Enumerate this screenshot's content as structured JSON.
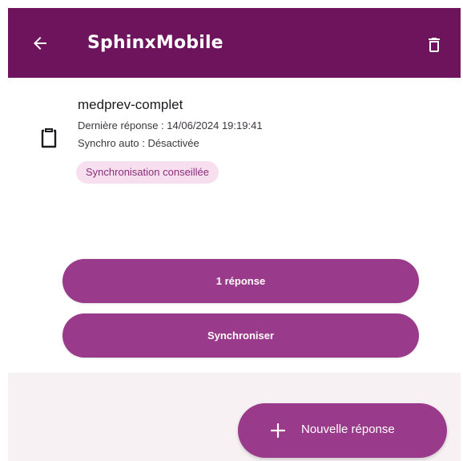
{
  "colors": {
    "app_bar": "#6e145d",
    "primary_button": "#9a3a8a",
    "badge_background": "#f8dff0",
    "badge_text": "#8a2f78",
    "page_background": "#f7f1f4"
  },
  "app_bar": {
    "title": "SphinxMobile",
    "back_icon": "arrow-left-icon",
    "delete_icon": "trash-icon"
  },
  "survey": {
    "icon": "clipboard-icon",
    "name": "medprev-complet",
    "last_response": "Dernière réponse : 14/06/2024 19:19:41",
    "auto_sync": "Synchro auto : Désactivée",
    "badge": "Synchronisation conseillée"
  },
  "actions": {
    "responses_label": "1 réponse",
    "sync_label": "Synchroniser"
  },
  "fab": {
    "icon": "plus-icon",
    "label": "Nouvelle réponse"
  }
}
